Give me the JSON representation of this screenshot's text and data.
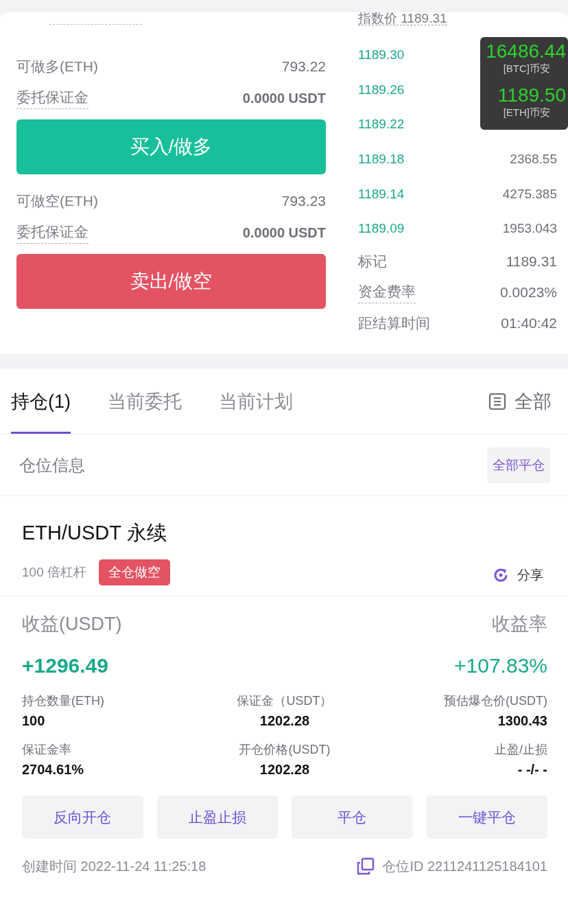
{
  "index_price": "指数价 1189.31",
  "long": {
    "label": "可做多(ETH)",
    "value": "793.22",
    "margin_label": "委托保证金",
    "margin_value": "0.0000 USDT",
    "button": "买入/做多",
    "kind": "buy"
  },
  "short": {
    "label": "可做空(ETH)",
    "value": "793.23",
    "margin_label": "委托保证金",
    "margin_value": "0.0000 USDT",
    "button": "卖出/做空",
    "kind": "sell"
  },
  "order_book": [
    {
      "price": "1189.30"
    },
    {
      "price": "1189.26"
    },
    {
      "price": "1189.22"
    },
    {
      "price": "1189.18",
      "quantity": "2368.55"
    },
    {
      "price": "1189.14",
      "quantity": "4275.385"
    },
    {
      "price": "1189.09",
      "quantity": "1953.043"
    }
  ],
  "market_stats": [
    {
      "label": "标记",
      "value": "1189.31",
      "dashed": false
    },
    {
      "label": "资金费率",
      "value": "0.0023%",
      "dashed": true
    },
    {
      "label": "距结算时间",
      "value": "01:40:42",
      "dashed": false
    }
  ],
  "ticker_overlay": [
    {
      "price": "16486.44",
      "source": "[BTC]币安"
    },
    {
      "price": "1189.50",
      "source": "[ETH]币安"
    }
  ],
  "tabs": [
    {
      "label": "持仓(1)",
      "selected": true
    },
    {
      "label": "当前委托",
      "selected": false
    },
    {
      "label": "当前计划",
      "selected": false
    }
  ],
  "filter": "全部",
  "section_title": "仓位信息",
  "close_all_button": "全部平仓",
  "position": {
    "symbol": "ETH/USDT 永续",
    "leverage": "100 倍杠杆",
    "tag": "全仓做空",
    "share": "分享",
    "pnl_label": "收益(USDT)",
    "roe_label": "收益率",
    "pnl": "+1296.49",
    "roe": "+107.83%",
    "fields": [
      {
        "label": "持仓数量(ETH)",
        "value": "100"
      },
      {
        "label": "保证金（USDT）",
        "value": "1202.28"
      },
      {
        "label": "预估爆仓价(USDT)",
        "value": "1300.43"
      },
      {
        "label": "保证金率",
        "value": "2704.61%"
      },
      {
        "label": "开仓价格(USDT)",
        "value": "1202.28"
      },
      {
        "label": "止盈/止损",
        "value": "- -/- -"
      }
    ],
    "actions": [
      "反向开仓",
      "止盈止损",
      "平仓",
      "一键平仓"
    ],
    "created": "创建时间 2022-11-24 11:25:18",
    "position_id": "仓位ID 2211241125184101"
  }
}
